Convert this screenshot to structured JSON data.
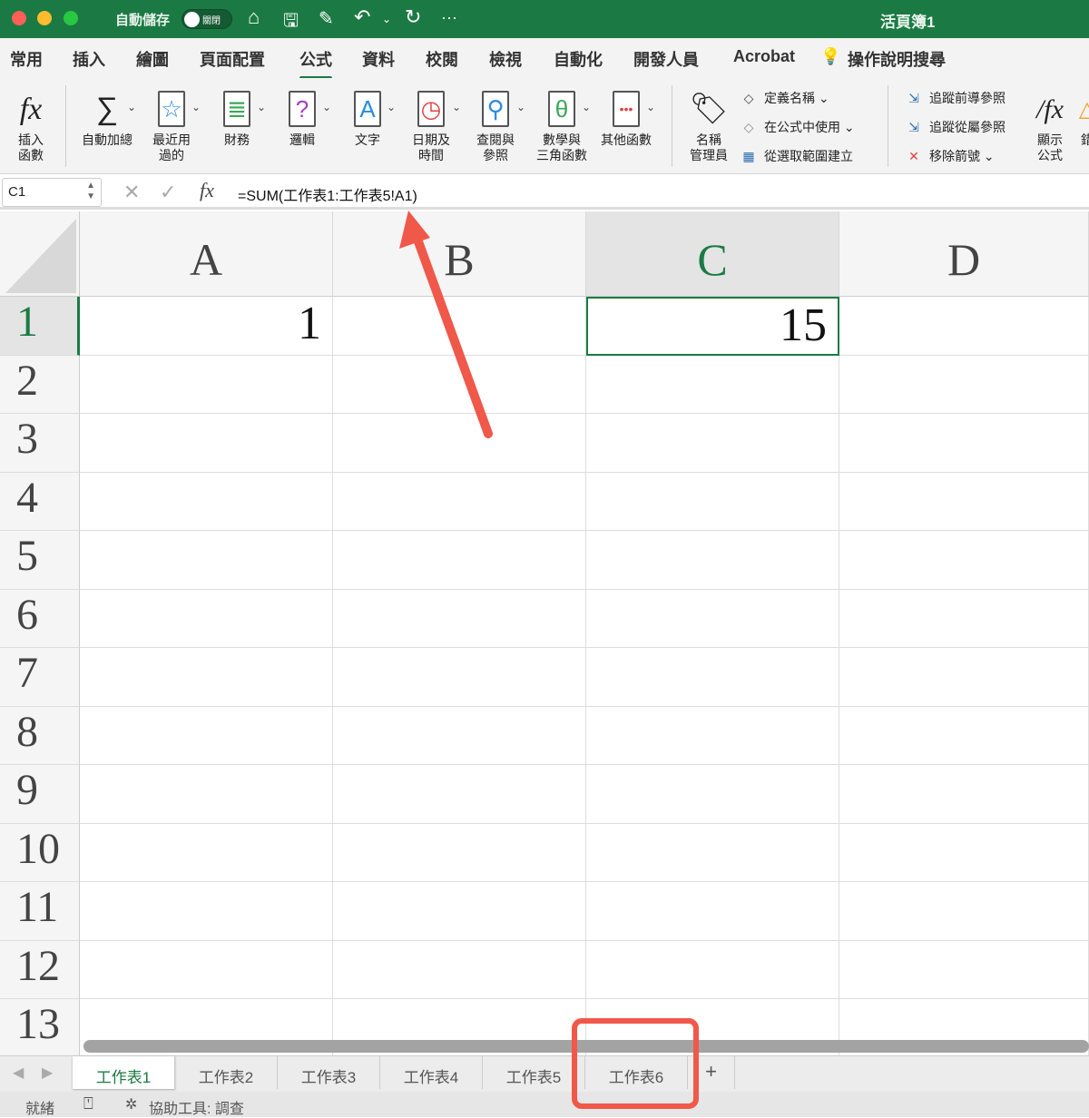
{
  "title_bar": {
    "autosave_label": "自動儲存",
    "autosave_state": "關閉",
    "workbook_title": "活頁簿1"
  },
  "menu": [
    "常用",
    "插入",
    "繪圖",
    "頁面配置",
    "公式",
    "資料",
    "校閱",
    "檢視",
    "自動化",
    "開發人員",
    "Acrobat"
  ],
  "active_menu": "公式",
  "help_search": "操作說明搜尋",
  "ribbon": {
    "insert_function": [
      "插入",
      "函數"
    ],
    "autosum": "自動加總",
    "recent": [
      "最近用",
      "過的"
    ],
    "financial": "財務",
    "logical": "邏輯",
    "text": "文字",
    "datetime": [
      "日期及",
      "時間"
    ],
    "lookup": [
      "查閱與",
      "參照"
    ],
    "math": [
      "數學與",
      "三角函數"
    ],
    "more": "其他函數",
    "name_manager": [
      "名稱",
      "管理員"
    ],
    "define_name": "定義名稱",
    "use_in_formula": "在公式中使用",
    "create_from_selection": "從選取範圍建立",
    "trace_precedents": "追蹤前導參照",
    "trace_dependents": "追蹤從屬參照",
    "remove_arrows": "移除箭號",
    "show_formulas": [
      "顯示",
      "公式"
    ],
    "error_check": "錯"
  },
  "formula_bar": {
    "name_box": "C1",
    "fx": "fx",
    "formula": "=SUM(工作表1:工作表5!A1)"
  },
  "columns": [
    "A",
    "B",
    "C",
    "D"
  ],
  "rows": [
    "1",
    "2",
    "3",
    "4",
    "5",
    "6",
    "7",
    "8",
    "9",
    "10",
    "11",
    "12",
    "13"
  ],
  "cells": {
    "A1": "1",
    "C1": "15"
  },
  "sheets": [
    "工作表1",
    "工作表2",
    "工作表3",
    "工作表4",
    "工作表5",
    "工作表6"
  ],
  "add_sheet": "+",
  "status": {
    "ready": "就緒",
    "accessibility": "協助工具: 調查"
  },
  "colors": {
    "accent": "#1b7a43",
    "annotation": "#f0584a"
  }
}
